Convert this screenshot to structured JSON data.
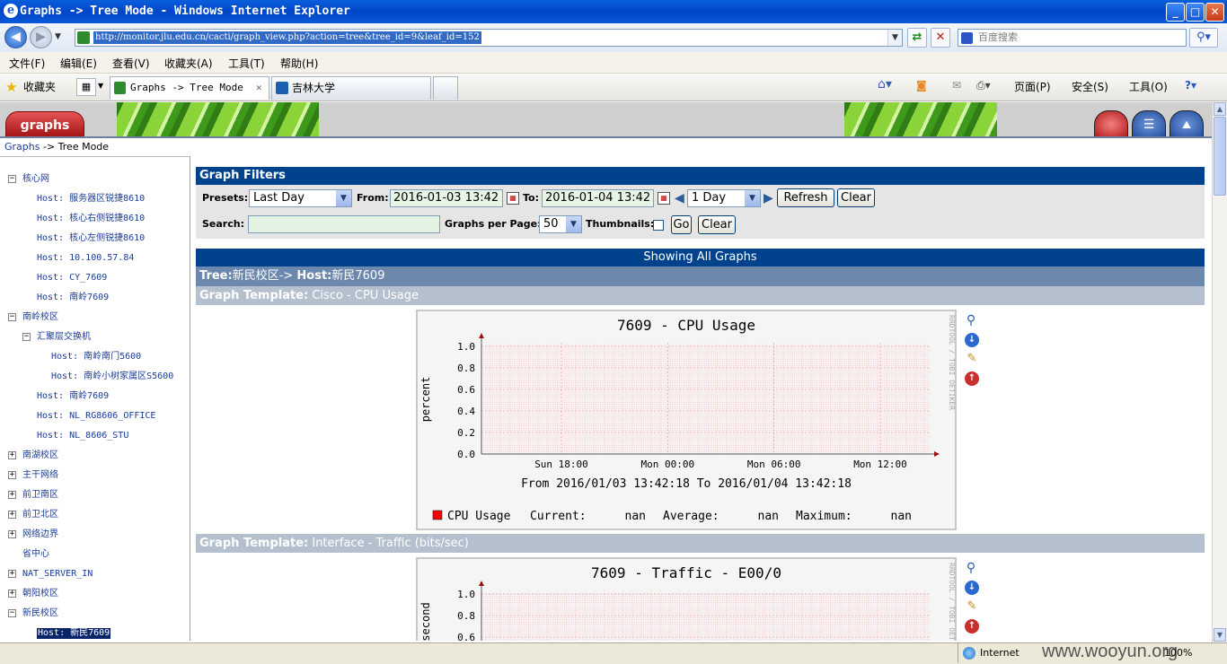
{
  "window": {
    "title": "Graphs -> Tree Mode - Windows Internet Explorer",
    "min": "_",
    "max": "□",
    "close": "✕"
  },
  "address": {
    "url": "http://monitor.jlu.edu.cn/cacti/graph_view.php?action=tree&tree_id=9&leaf_id=152",
    "search_placeholder": "百度搜索"
  },
  "menu": [
    "文件(F)",
    "编辑(E)",
    "查看(V)",
    "收藏夹(A)",
    "工具(T)",
    "帮助(H)"
  ],
  "favbar": {
    "favorites": "收藏夹",
    "tabs": [
      {
        "label": "Graphs -> Tree Mode",
        "active": true
      },
      {
        "label": "吉林大学",
        "active": false
      }
    ],
    "commands": [
      "页面(P)",
      "安全(S)",
      "工具(O)"
    ]
  },
  "cacti": {
    "graphs_tab": "graphs",
    "breadcrumb_link": "Graphs",
    "breadcrumb_rest": " -> Tree Mode"
  },
  "tree": [
    {
      "label": "核心网",
      "level": 0,
      "box": "−"
    },
    {
      "label": "Host: 服务器区锐捷8610",
      "level": 1
    },
    {
      "label": "Host: 核心右侧锐捷8610",
      "level": 1
    },
    {
      "label": "Host: 核心左侧锐捷8610",
      "level": 1
    },
    {
      "label": "Host: 10.100.57.84",
      "level": 1
    },
    {
      "label": "Host: CY_7609",
      "level": 1
    },
    {
      "label": "Host: 南岭7609",
      "level": 1
    },
    {
      "label": "南岭校区",
      "level": 0,
      "box": "−"
    },
    {
      "label": "汇聚层交换机",
      "level": 1,
      "box": "−"
    },
    {
      "label": "Host: 南岭南门5600",
      "level": 2
    },
    {
      "label": "Host: 南岭小树家属区S5600",
      "level": 2
    },
    {
      "label": "Host: 南岭7609",
      "level": 1
    },
    {
      "label": "Host: NL_RG8606_OFFICE",
      "level": 1
    },
    {
      "label": "Host: NL_8606_STU",
      "level": 1
    },
    {
      "label": "南湖校区",
      "level": 0,
      "box": "+"
    },
    {
      "label": "主干网络",
      "level": 0,
      "box": "+"
    },
    {
      "label": "前卫南区",
      "level": 0,
      "box": "+"
    },
    {
      "label": "前卫北区",
      "level": 0,
      "box": "+"
    },
    {
      "label": "网络边界",
      "level": 0,
      "box": "+"
    },
    {
      "label": "省中心",
      "level": 0
    },
    {
      "label": "NAT_SERVER_IN",
      "level": 0,
      "box": "+"
    },
    {
      "label": "朝阳校区",
      "level": 0,
      "box": "+"
    },
    {
      "label": "新民校区",
      "level": 0,
      "box": "−"
    },
    {
      "label": "Host: 新民7609",
      "level": 1,
      "selected": true
    }
  ],
  "filters": {
    "header": "Graph Filters",
    "presets_label": "Presets:",
    "presets_value": "Last Day",
    "from_label": "From:",
    "from_value": "2016-01-03 13:42",
    "to_label": "To:",
    "to_value": "2016-01-04 13:42",
    "span_value": "1 Day",
    "refresh": "Refresh",
    "clear1": "Clear",
    "search_label": "Search:",
    "search_value": "",
    "per_page_label": "Graphs per Page:",
    "per_page_value": "50",
    "thumbnails_label": "Thumbnails:",
    "go": "Go",
    "clear2": "Clear"
  },
  "showing": "Showing All Graphs",
  "tree_header": {
    "tree_label": "Tree:",
    "tree_value": "新民校区",
    "sep": "-> ",
    "host_label": "Host:",
    "host_value": "新民7609"
  },
  "templates": [
    {
      "label": "Graph Template:",
      "value": "Cisco - CPU Usage"
    },
    {
      "label": "Graph Template:",
      "value": "Interface - Traffic (bits/sec)"
    }
  ],
  "chart_data": [
    {
      "type": "line",
      "title": "7609 - CPU Usage",
      "ylabel": "percent",
      "ylim": [
        0,
        1.0
      ],
      "yticks": [
        "0.0",
        "0.2",
        "0.4",
        "0.6",
        "0.8",
        "1.0"
      ],
      "xticks": [
        "Sun 18:00",
        "Mon 00:00",
        "Mon 06:00",
        "Mon 12:00"
      ],
      "period": "From 2016/01/03 13:42:18 To 2016/01/04 13:42:18",
      "side_text": "RRDTOOL / TOBI OETIKER",
      "series": [
        {
          "name": "CPU Usage",
          "values": [],
          "color": "#ff0000"
        }
      ],
      "legend": {
        "current_label": "Current:",
        "current": "nan",
        "average_label": "Average:",
        "average": "nan",
        "maximum_label": "Maximum:",
        "maximum": "nan"
      }
    },
    {
      "type": "line",
      "title": "7609 - Traffic - E00/0",
      "ylabel": "second",
      "ylim": [
        0,
        1.0
      ],
      "yticks": [
        "0.6",
        "0.8",
        "1.0"
      ],
      "side_text": "RRDTOOL / TOBI OETIKER",
      "series": []
    }
  ],
  "statusbar": {
    "zone": "Internet",
    "zoom": "100%",
    "watermark": "www.wooyun.org"
  },
  "colors": {
    "cacti_blue": "#00438c",
    "tree_header": "#6d88ad",
    "template_header": "#b5c0cf",
    "graphs_tab": "#c41f1f"
  }
}
